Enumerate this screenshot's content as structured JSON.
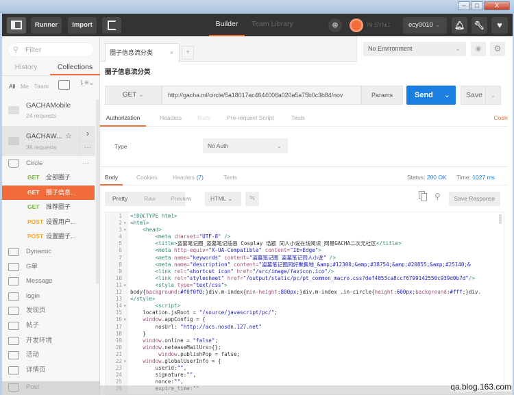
{
  "window": {
    "controls": [
      "–",
      "□",
      "X"
    ]
  },
  "toolbar": {
    "runner": "Runner",
    "import": "Import",
    "builder": "Builder",
    "team_library": "Team Library",
    "sync": "IN SYNC",
    "user": "ecy0010"
  },
  "sidebar": {
    "filter_placeholder": "Filter",
    "tabs": [
      "History",
      "Collections"
    ],
    "filters": [
      "All",
      "Me",
      "Team"
    ],
    "collections": [
      {
        "name": "GACHAMobile",
        "count": "24 requests"
      },
      {
        "name": "GACHAW...",
        "count": "38 requests"
      }
    ],
    "folder_open": "Circle",
    "requests": [
      {
        "method": "GET",
        "name": "全部圈子"
      },
      {
        "method": "GET",
        "name": "圈子信息..."
      },
      {
        "method": "GET",
        "name": "推荐圈子"
      },
      {
        "method": "POST",
        "name": "设置用户..."
      },
      {
        "method": "POST",
        "name": "设置圈子..."
      }
    ],
    "folders": [
      "Dynamic",
      "G单",
      "Message",
      "login",
      "发现页",
      "帖子",
      "开发环境",
      "活动",
      "详情页",
      "Post"
    ]
  },
  "main": {
    "tab_label": "圈子信息流分类",
    "tab_close": "×",
    "tab_add": "+",
    "environment": "No Environment",
    "request_title": "圈子信息流分类",
    "method": "GET",
    "url": "http://gacha.ml/circle/5a18017ac4644006a020a5a75b0c3b84/nov",
    "params": "Params",
    "send": "Send",
    "save": "Save",
    "req_tabs": [
      "Authorization",
      "Headers",
      "Body",
      "Pre-request Script",
      "Tests"
    ],
    "code_link": "Code",
    "type_label": "Type",
    "auth_type": "No Auth",
    "resp_tabs": [
      "Body",
      "Cookies",
      "Headers",
      "Tests"
    ],
    "headers_count": "(7)",
    "status_label": "Status:",
    "status": "200 OK",
    "time_label": "Time:",
    "time": "1027 ms",
    "view_modes": [
      "Pretty",
      "Raw",
      "Preview"
    ],
    "format": "HTML",
    "save_response": "Save Response",
    "code_lines": [
      {
        "n": "1",
        "f": "",
        "t": [
          [
            "t",
            "<!DOCTYPE html>"
          ]
        ]
      },
      {
        "n": "2",
        "f": "▾",
        "t": [
          [
            "t",
            "<html>"
          ]
        ]
      },
      {
        "n": "3",
        "f": "▾",
        "t": [
          [
            "p",
            "    "
          ],
          [
            "t",
            "<head>"
          ]
        ]
      },
      {
        "n": "4",
        "f": "",
        "t": [
          [
            "p",
            "        "
          ],
          [
            "t",
            "<meta "
          ],
          [
            "a",
            "charset="
          ],
          [
            "s",
            "\"UTF-8\""
          ],
          [
            "t",
            " />"
          ]
        ]
      },
      {
        "n": "5",
        "f": "",
        "t": [
          [
            "p",
            "        "
          ],
          [
            "t",
            "<title>"
          ],
          [
            "p",
            "盗墓笔记圈_盗墓笔记插画 Cosplay 话题 同人小说在线阅读_网易GACHA二次元社区"
          ],
          [
            "t",
            "</title>"
          ]
        ]
      },
      {
        "n": "6",
        "f": "",
        "t": [
          [
            "p",
            "        "
          ],
          [
            "t",
            "<meta "
          ],
          [
            "a",
            "http-equiv="
          ],
          [
            "s",
            "\"X-UA-Compatible\""
          ],
          [
            "a",
            " content="
          ],
          [
            "s",
            "\"IE=Edge\""
          ],
          [
            "t",
            ">"
          ]
        ]
      },
      {
        "n": "7",
        "f": "",
        "t": [
          [
            "p",
            "        "
          ],
          [
            "t",
            "<meta "
          ],
          [
            "a",
            "name="
          ],
          [
            "s",
            "\"keywords\""
          ],
          [
            "a",
            " content="
          ],
          [
            "s",
            "\"盗墓笔记圈 盗墓笔记同人小说\""
          ],
          [
            "t",
            " />"
          ]
        ]
      },
      {
        "n": "8",
        "f": "",
        "t": [
          [
            "p",
            "        "
          ],
          [
            "t",
            "<meta "
          ],
          [
            "a",
            "name="
          ],
          [
            "s",
            "\"description\""
          ],
          [
            "a",
            " content="
          ],
          [
            "s",
            "\"盗墓笔记圈同好聚集地_&amp;#12300;&amp;#38754;&amp;#20855;&amp;#25140;&"
          ]
        ]
      },
      {
        "n": "9",
        "f": "",
        "t": [
          [
            "p",
            "        "
          ],
          [
            "t",
            "<link "
          ],
          [
            "a",
            "rel="
          ],
          [
            "s",
            "\"shortcut icon\""
          ],
          [
            "a",
            " href="
          ],
          [
            "s",
            "\"/src/image/favicon.ico\""
          ],
          [
            "t",
            "/>"
          ]
        ]
      },
      {
        "n": "10",
        "f": "",
        "t": [
          [
            "p",
            "        "
          ],
          [
            "t",
            "<link "
          ],
          [
            "a",
            "rel="
          ],
          [
            "s",
            "\"stylesheet\""
          ],
          [
            "a",
            " href="
          ],
          [
            "s",
            "\"/output/static/pc/pt_common_macro.css?def4053ca8ccf6799142550c939d0b7d\""
          ],
          [
            "t",
            "/>"
          ]
        ]
      },
      {
        "n": "11",
        "f": "▾",
        "t": [
          [
            "p",
            "        "
          ],
          [
            "t",
            "<style "
          ],
          [
            "a",
            "type="
          ],
          [
            "s",
            "\"text/css\""
          ],
          [
            "t",
            ">"
          ]
        ]
      },
      {
        "n": "12",
        "f": "",
        "t": [
          [
            "p",
            "body{"
          ],
          [
            "a",
            "background"
          ],
          [
            "p",
            ":"
          ],
          [
            "s",
            "#f0f0f0"
          ],
          [
            "p",
            ";}div.m-index{"
          ],
          [
            "a",
            "min-height"
          ],
          [
            "p",
            ":"
          ],
          [
            "s",
            "800px"
          ],
          [
            "p",
            ";}div.m-index .in-circle{"
          ],
          [
            "a",
            "height"
          ],
          [
            "p",
            ":"
          ],
          [
            "s",
            "600px"
          ],
          [
            "p",
            ";"
          ],
          [
            "a",
            "background"
          ],
          [
            "p",
            ":"
          ],
          [
            "s",
            "#fff"
          ],
          [
            "p",
            ";}div."
          ]
        ]
      },
      {
        "n": "13",
        "f": "",
        "t": [
          [
            "t",
            "</style>"
          ]
        ]
      },
      {
        "n": "14",
        "f": "▾",
        "t": [
          [
            "p",
            "        "
          ],
          [
            "t",
            "<script>"
          ]
        ]
      },
      {
        "n": "15",
        "f": "",
        "t": [
          [
            "p",
            "    location.jsRoot = "
          ],
          [
            "s",
            "\"/source/javascript/pc/\""
          ],
          [
            "p",
            ";"
          ]
        ]
      },
      {
        "n": "16",
        "f": "▾",
        "t": [
          [
            "p",
            "    "
          ],
          [
            "a",
            "window"
          ],
          [
            "p",
            ".appConfig = {"
          ]
        ]
      },
      {
        "n": "17",
        "f": "",
        "t": [
          [
            "p",
            "        nosUrl: "
          ],
          [
            "s",
            "\"http://acs.nosdn.127.net\""
          ]
        ]
      },
      {
        "n": "18",
        "f": "",
        "t": [
          [
            "p",
            "    }"
          ]
        ]
      },
      {
        "n": "19",
        "f": "",
        "t": [
          [
            "p",
            "    "
          ],
          [
            "a",
            "window"
          ],
          [
            "p",
            ".online = "
          ],
          [
            "s",
            "\"false\""
          ],
          [
            "p",
            ";"
          ]
        ]
      },
      {
        "n": "20",
        "f": "",
        "t": [
          [
            "p",
            "    "
          ],
          [
            "a",
            "window"
          ],
          [
            "p",
            ".neteaseMailUrs={};"
          ]
        ]
      },
      {
        "n": "21",
        "f": "",
        "t": [
          [
            "p",
            "         "
          ],
          [
            "a",
            "window"
          ],
          [
            "p",
            ".publishPop = false;"
          ]
        ]
      },
      {
        "n": "22",
        "f": "▾",
        "t": [
          [
            "p",
            "    "
          ],
          [
            "a",
            "window"
          ],
          [
            "p",
            ".globalUserInfo = {"
          ]
        ]
      },
      {
        "n": "23",
        "f": "",
        "t": [
          [
            "p",
            "        userid:"
          ],
          [
            "s",
            "\"\""
          ],
          [
            "p",
            ","
          ]
        ]
      },
      {
        "n": "24",
        "f": "",
        "t": [
          [
            "p",
            "        signature:"
          ],
          [
            "s",
            "\"\""
          ],
          [
            "p",
            ","
          ]
        ]
      },
      {
        "n": "25",
        "f": "",
        "t": [
          [
            "p",
            "        nonce:"
          ],
          [
            "s",
            "\"\""
          ],
          [
            "p",
            ","
          ]
        ]
      },
      {
        "n": "26",
        "f": "",
        "t": [
          [
            "p",
            "        expire_time:"
          ],
          [
            "s",
            "\"\""
          ]
        ]
      }
    ]
  },
  "watermark": "qa.blog.163.com",
  "colors": {
    "accent": "#f26b3a",
    "send": "#1a7fe0",
    "get": "#6bbd2e",
    "post": "#f5a623"
  }
}
